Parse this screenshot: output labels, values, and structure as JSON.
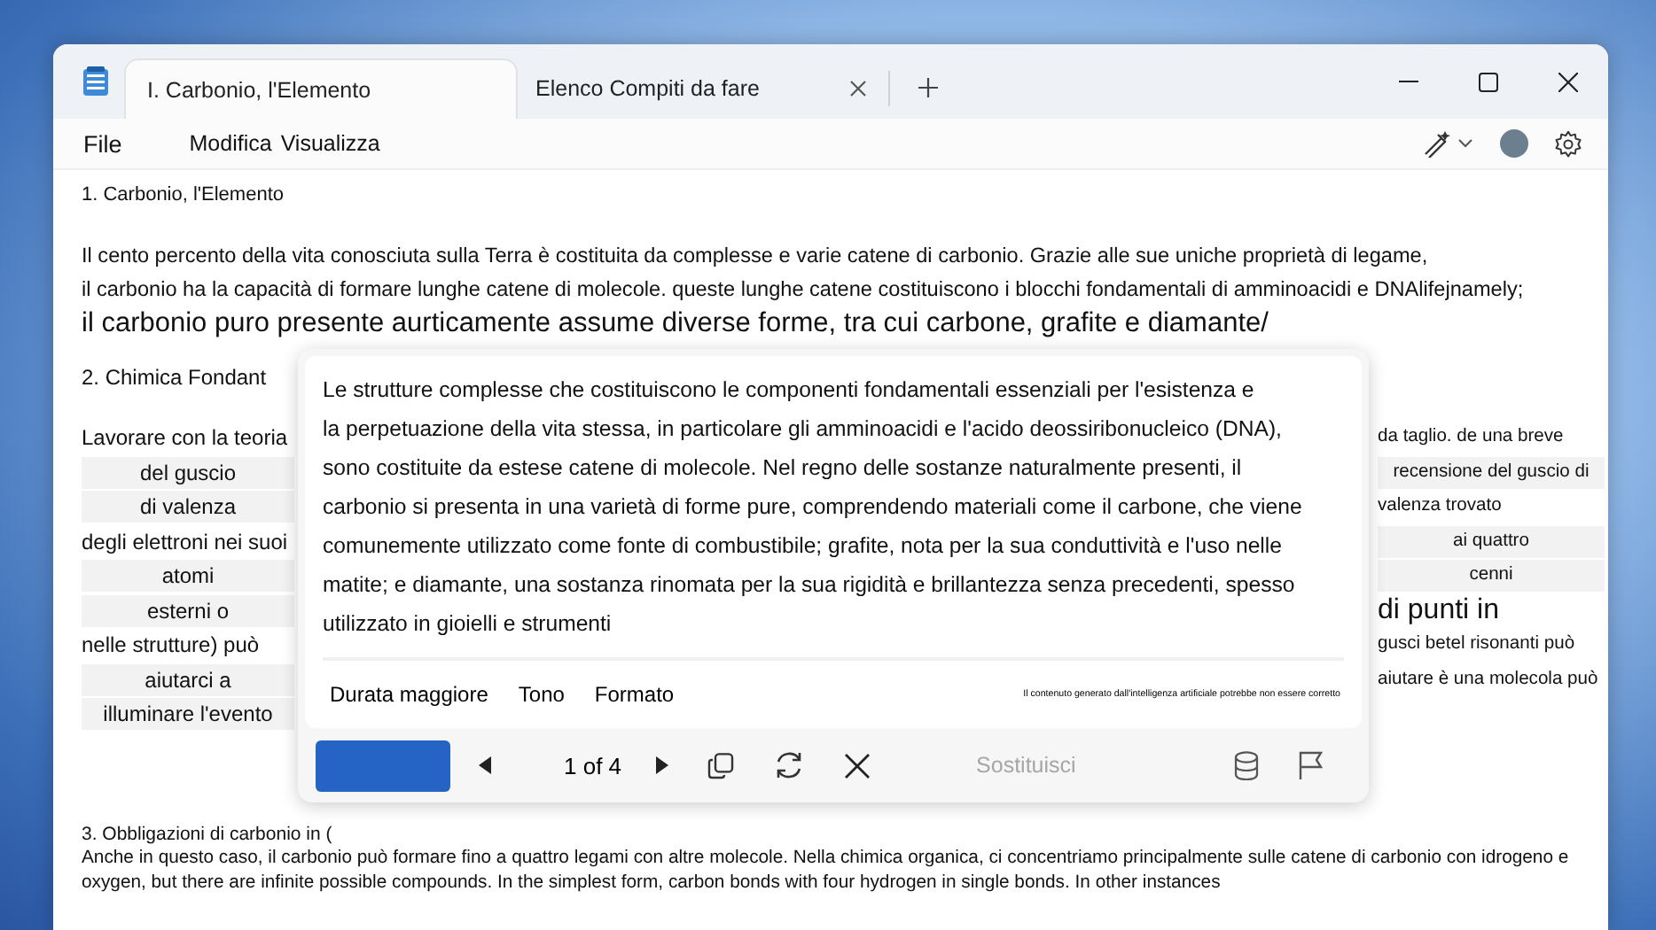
{
  "window": {
    "tabs": [
      {
        "label": "I. Carbonio, l'Elemento",
        "selected": true
      },
      {
        "label": "Elenco Compiti da fare",
        "selected": false
      }
    ]
  },
  "menu": [
    "File",
    "Modifica",
    "Visualizza"
  ],
  "document": {
    "heading_1": "1. Carbonio, l'Elemento",
    "paragraph_1": [
      {
        "kind": "normal",
        "text": "Il cento percento della vita conosciuta sulla Terra è costituita da complesse e varie catene di carbonio. Grazie alle sue uniche proprietà di legame,"
      },
      {
        "kind": "normal",
        "text": "il carbonio ha la capacità di formare lunghe catene di molecole. queste lunghe catene costituiscono i blocchi fondamentali di amminoacidi e DNAlifejnamely;"
      },
      {
        "kind": "large",
        "text": "il carbonio puro presente aurticamente assume diverse forme, tra cui carbone, grafite e diamante/"
      }
    ],
    "heading_2": "2. Chimica Fondant",
    "left_column": [
      {
        "kind": "plain",
        "text": "Lavorare con la teoria"
      },
      {
        "kind": "cell",
        "text": "del guscio"
      },
      {
        "kind": "cell",
        "text": "di valenza"
      },
      {
        "kind": "plain",
        "text": "degli elettroni nei suoi"
      },
      {
        "kind": "cell",
        "text": "atomi"
      },
      {
        "kind": "cell",
        "text": "esterni o"
      },
      {
        "kind": "plain",
        "text": "nelle strutture) può"
      },
      {
        "kind": "cell",
        "text": "aiutarci a"
      },
      {
        "kind": "cell",
        "text": "illuminare l'evento"
      }
    ],
    "right_column": [
      {
        "kind": "plain",
        "text": "da taglio. de una breve"
      },
      {
        "kind": "cell",
        "text": "recensione del guscio di"
      },
      {
        "kind": "plain",
        "text": "valenza trovato"
      },
      {
        "kind": "cell",
        "text": "ai quattro"
      },
      {
        "kind": "cell",
        "text": "cenni"
      },
      {
        "kind": "large",
        "text": "di punti in"
      },
      {
        "kind": "plain",
        "text": "gusci betel risonanti può"
      },
      {
        "kind": "plain",
        "text": "aiutare è una molecola può"
      }
    ],
    "heading_3": "3. Obbligazioni di carbonio in (",
    "paragraph_3": [
      "Anche in questo caso, il carbonio può formare fino a quattro legami con altre molecole. Nella chimica organica, ci concentriamo principalmente sulle catene di carbonio con idrogeno e",
      "oxygen, but there are infinite possible compounds. In the simplest form, carbon bonds with four hydrogen in single bonds. In other instances"
    ]
  },
  "rewrite_popup": {
    "lines": [
      "Le strutture complesse che costituiscono le componenti fondamentali essenziali per l'esistenza e",
      "la perpetuazione della vita stessa, in particolare gli amminoacidi e l'acido deossiribonucleico (DNA),",
      "sono costituite da estese catene di molecole. Nel regno delle sostanze naturalmente presenti, il",
      "carbonio si presenta in una varietà di forme pure, comprendendo materiali come il carbone, che viene",
      "comunemente utilizzato come fonte di combustibile; grafite, nota per la sua conduttività e l'uso nelle",
      "matite; e diamante, una sostanza rinomata per la sua rigidità e brillantezza senza precedenti, spesso",
      "utilizzato in gioielli e strumenti"
    ],
    "options": [
      "Durata maggiore",
      "Tono",
      "Formato"
    ],
    "disclaimer": "Il contenuto generato dall'intelligenza artificiale potrebbe non essere corretto",
    "pager": "1 of 4",
    "replace_label": "Sostituisci"
  }
}
